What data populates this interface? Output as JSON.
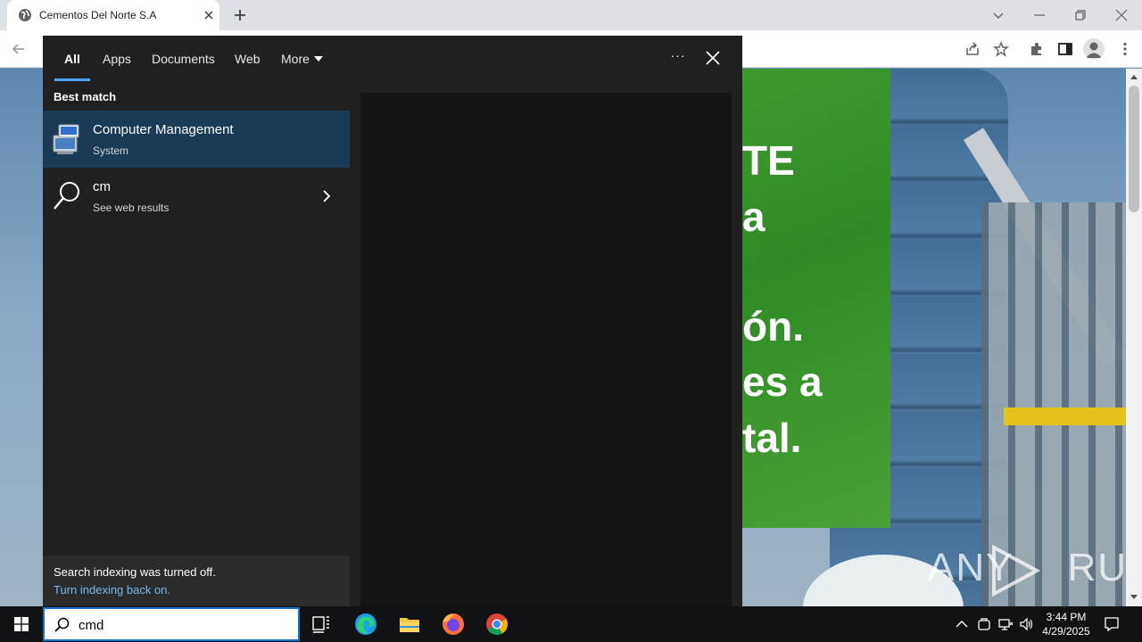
{
  "browser": {
    "tab_title": "Cementos Del Norte S.A"
  },
  "webpage": {
    "hero_lines": [
      "TE",
      "a",
      "ón.",
      "es a",
      "tal."
    ],
    "watermark_left": "ANY",
    "watermark_right": "RUN"
  },
  "search": {
    "tabs": [
      {
        "label": "All",
        "active": true
      },
      {
        "label": "Apps"
      },
      {
        "label": "Documents"
      },
      {
        "label": "Web"
      },
      {
        "label": "More"
      }
    ],
    "more_label": "More",
    "options_label": "···",
    "best_match_header": "Best match",
    "results": [
      {
        "title": "Computer Management",
        "subtitle": "System",
        "icon": "computer-management-icon",
        "selected": true
      },
      {
        "title": "cm",
        "subtitle": "See web results",
        "icon": "search-icon"
      }
    ],
    "indexing_notice": "Search indexing was turned off.",
    "indexing_link": "Turn indexing back on."
  },
  "taskbar": {
    "search_value": "cmd",
    "apps": [
      "task-view-icon",
      "edge-icon",
      "file-explorer-icon",
      "firefox-icon",
      "chrome-icon"
    ],
    "clock_time": "3:44 PM",
    "clock_date": "4/29/2025"
  },
  "colors": {
    "accent": "#1a73c9",
    "selected_row": "#1a3a55",
    "panel_bg": "#202020",
    "link": "#78b9eb"
  }
}
